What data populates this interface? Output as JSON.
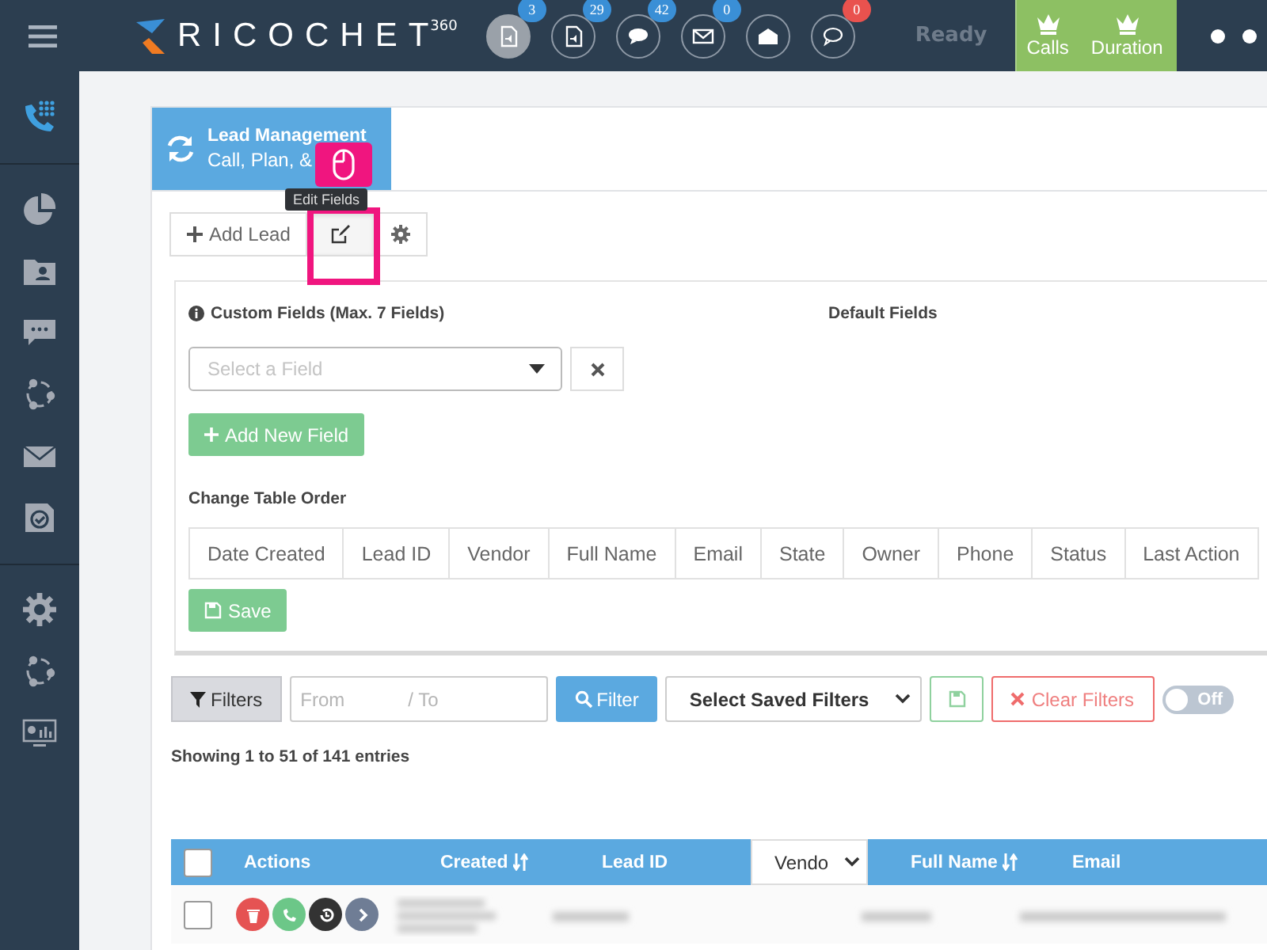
{
  "topbar": {
    "logo": "RICOCHET",
    "logo_sup": "360",
    "status": "Ready",
    "notifications": [
      {
        "kind": "doc",
        "selected": true,
        "badge": "3",
        "color": "#3a8fd6"
      },
      {
        "kind": "doc",
        "selected": false,
        "badge": "29",
        "color": "#3a8fd6"
      },
      {
        "kind": "chat",
        "selected": false,
        "badge": "42",
        "color": "#3a8fd6"
      },
      {
        "kind": "mail",
        "selected": false,
        "badge": "0",
        "color": "#3a8fd6"
      },
      {
        "kind": "open-mail",
        "selected": false
      },
      {
        "kind": "bubble",
        "selected": false,
        "badge": "0",
        "color": "#e9524e"
      }
    ],
    "stats": [
      "Calls",
      "Duration"
    ]
  },
  "sidebar": {
    "items": [
      {
        "kind": "phone",
        "selected": true
      },
      {
        "kind": "pie",
        "selected": false
      },
      {
        "kind": "contact",
        "selected": false
      },
      {
        "kind": "chat",
        "selected": false
      },
      {
        "kind": "share",
        "selected": false
      },
      {
        "kind": "mail",
        "selected": false
      },
      {
        "kind": "check",
        "selected": false
      },
      {
        "kind": "gear",
        "selected": false
      },
      {
        "kind": "share",
        "selected": false
      },
      {
        "kind": "monitor",
        "selected": false
      }
    ]
  },
  "header": {
    "title": "Lead Management",
    "subtitle": "Call, Plan, &"
  },
  "tooltip": "Edit Fields",
  "toolbar": [
    {
      "kind": "add",
      "label": "Add Lead",
      "selected": false
    },
    {
      "kind": "edit",
      "selected": true
    },
    {
      "kind": "gear",
      "selected": false
    }
  ],
  "fields_panel": {
    "custom_title": "Custom Fields (Max. 7 Fields)",
    "default_title": "Default Fields",
    "select": {
      "placeholder": "Select a Field"
    },
    "add_button": "Add New Field",
    "order_title": "Change Table Order",
    "columns": [
      "Date Created",
      "Lead ID",
      "Vendor",
      "Full Name",
      "Email",
      "State",
      "Owner",
      "Phone",
      "Status",
      "Last Action"
    ],
    "save_button": "Save"
  },
  "filters": {
    "filters_button": "Filters",
    "from_placeholder": "From",
    "to_placeholder": "/ To",
    "filter_button": "Filter",
    "saved_select": "Select Saved Filters",
    "clear_button": "Clear Filters",
    "toggle": {
      "label": "Off",
      "on": false
    }
  },
  "summary": "Showing 1 to 51 of 141 entries",
  "table": {
    "columns": [
      {
        "kind": "text",
        "label": "Actions",
        "sortable": false
      },
      {
        "kind": "text",
        "label": "Created",
        "sortable": true
      },
      {
        "kind": "text",
        "label": "Lead ID",
        "sortable": false
      },
      {
        "kind": "select",
        "label": "Vendo"
      },
      {
        "kind": "text",
        "label": "Full Name",
        "sortable": true
      },
      {
        "kind": "text",
        "label": "Email",
        "sortable": false
      }
    ],
    "all_checked": false,
    "rows": [
      {
        "checked": false,
        "actions": [
          {
            "kind": "delete"
          },
          {
            "kind": "call"
          },
          {
            "kind": "history"
          },
          {
            "kind": "open"
          }
        ]
      }
    ]
  }
}
